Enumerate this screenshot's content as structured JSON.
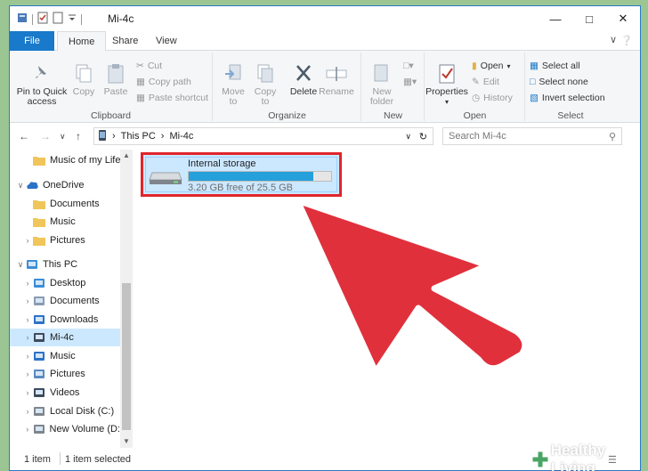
{
  "window": {
    "title": "Mi-4c"
  },
  "tabs": {
    "file": "File",
    "home": "Home",
    "share": "Share",
    "view": "View"
  },
  "ribbon": {
    "clipboard": {
      "label": "Clipboard",
      "pin": "Pin to Quick access",
      "copy": "Copy",
      "paste": "Paste",
      "cut": "Cut",
      "copy_path": "Copy path",
      "paste_shortcut": "Paste shortcut"
    },
    "organize": {
      "label": "Organize",
      "move_to": "Move to",
      "copy_to": "Copy to",
      "delete": "Delete",
      "rename": "Rename"
    },
    "new": {
      "label": "New",
      "new_folder": "New folder"
    },
    "open": {
      "label": "Open",
      "properties": "Properties",
      "open": "Open",
      "edit": "Edit",
      "history": "History"
    },
    "select": {
      "label": "Select",
      "select_all": "Select all",
      "select_none": "Select none",
      "invert": "Invert selection"
    }
  },
  "address": {
    "crumbs": [
      "This PC",
      "Mi-4c"
    ],
    "search_placeholder": "Search Mi-4c"
  },
  "nav": {
    "items": [
      {
        "label": "Music of my Life",
        "icon": "folder-icon"
      },
      {
        "label": "OneDrive",
        "icon": "cloud-icon"
      },
      {
        "label": "Documents",
        "icon": "folder-icon"
      },
      {
        "label": "Music",
        "icon": "folder-icon"
      },
      {
        "label": "Pictures",
        "icon": "folder-icon"
      },
      {
        "label": "This PC",
        "icon": "computer-icon"
      },
      {
        "label": "Desktop",
        "icon": "desktop-icon"
      },
      {
        "label": "Documents",
        "icon": "documents-icon"
      },
      {
        "label": "Downloads",
        "icon": "download-icon"
      },
      {
        "label": "Mi-4c",
        "icon": "phone-icon"
      },
      {
        "label": "Music",
        "icon": "music-icon"
      },
      {
        "label": "Pictures",
        "icon": "pictures-icon"
      },
      {
        "label": "Videos",
        "icon": "videos-icon"
      },
      {
        "label": "Local Disk (C:)",
        "icon": "disk-icon"
      },
      {
        "label": "New Volume (D:",
        "icon": "disk-icon"
      }
    ]
  },
  "content": {
    "drive_name": "Internal storage",
    "drive_free": "3.20 GB free of 25.5 GB",
    "used_fraction": 0.875
  },
  "status": {
    "count": "1 item",
    "selected": "1 item selected"
  },
  "brand": {
    "name": "Healthy Living"
  },
  "colors": {
    "accent": "#1979ca",
    "arrow": "#e0303c",
    "highlight_border": "#e0252d",
    "background": "#9bc694"
  }
}
